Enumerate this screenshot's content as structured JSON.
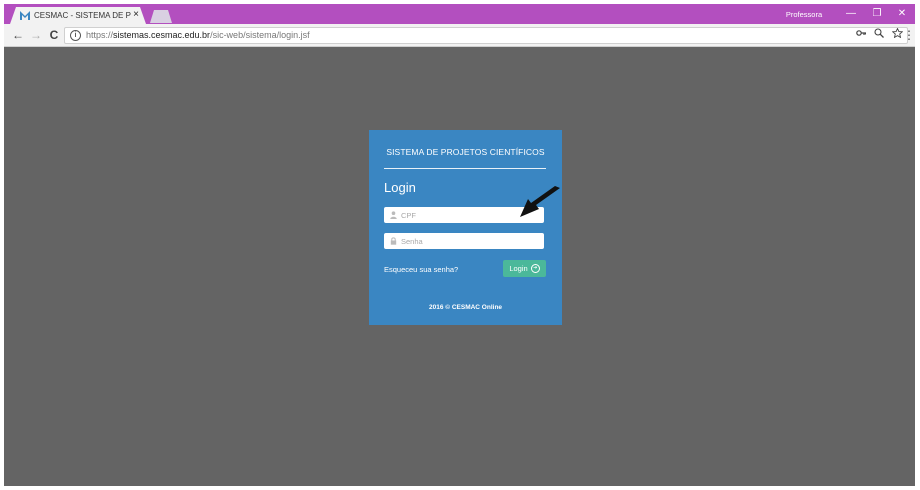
{
  "browser": {
    "tab": {
      "title": "CESMAC - SISTEMA DE P",
      "close_glyph": "×",
      "favicon": "cesmac-m-icon"
    },
    "profile_name": "Professora",
    "window_controls": {
      "minimize": "—",
      "restore": "❐",
      "close": "✕"
    },
    "nav": {
      "back": "←",
      "forward": "→",
      "reload": "C"
    },
    "address": {
      "scheme": "https://",
      "host": "sistemas.cesmac.edu.br",
      "path": "/sic-web/sistema/login.jsf",
      "icons": [
        "key-icon",
        "zoom-icon",
        "star-icon"
      ]
    },
    "menu": "⋮",
    "colors": {
      "titlebar": "#b34fbf",
      "toolbar": "#f2f2f2"
    }
  },
  "login": {
    "system_title": "SISTEMA DE PROJETOS CIENTÍFICOS",
    "heading": "Login",
    "cpf_placeholder": "CPF",
    "password_placeholder": "Senha",
    "forgot_link": "Esqueceu sua senha?",
    "submit_label": "Login",
    "footer": "2016 © CESMAC Online",
    "colors": {
      "card": "#3a86c2",
      "button": "#4bb89a",
      "overlay": "#646464"
    }
  }
}
